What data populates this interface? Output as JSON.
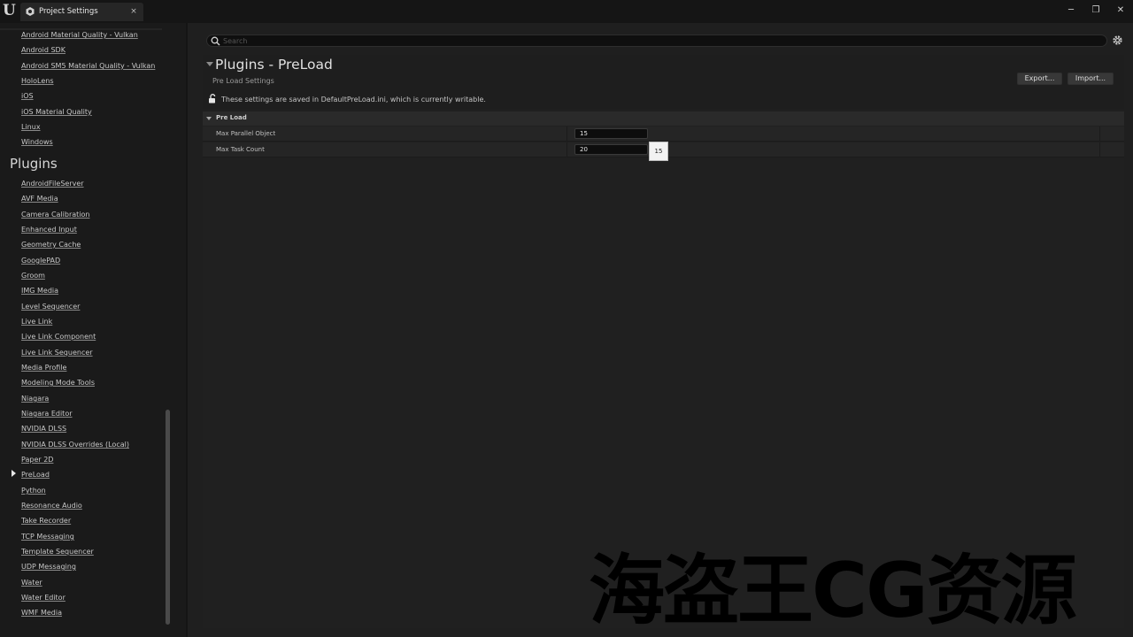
{
  "window": {
    "tab_label": "Project Settings",
    "tab_close_glyph": "×",
    "minimize_glyph": "─",
    "restore_glyph": "❐",
    "close_glyph": "✕"
  },
  "sidebar": {
    "platform_items": [
      "Android Material Quality - Vulkan",
      "Android SDK",
      "Android SM5 Material Quality - Vulkan",
      "HoloLens",
      "iOS",
      "iOS Material Quality",
      "Linux",
      "Windows"
    ],
    "plugins_heading": "Plugins",
    "plugin_items": [
      "AndroidFileServer",
      "AVF Media",
      "Camera Calibration",
      "Enhanced Input",
      "Geometry Cache",
      "GooglePAD",
      "Groom",
      "IMG Media",
      "Level Sequencer",
      "Live Link",
      "Live Link Component",
      "Live Link Sequencer",
      "Media Profile",
      "Modeling Mode Tools",
      "Niagara",
      "Niagara Editor",
      "NVIDIA DLSS",
      "NVIDIA DLSS Overrides (Local)",
      "Paper 2D",
      "PreLoad",
      "Python",
      "Resonance Audio",
      "Take Recorder",
      "TCP Messaging",
      "Template Sequencer",
      "UDP Messaging",
      "Water",
      "Water Editor",
      "WMF Media"
    ],
    "selected_item": "PreLoad"
  },
  "search": {
    "placeholder": "Search",
    "value": ""
  },
  "page": {
    "title": "Plugins - PreLoad",
    "subtitle": "Pre Load Settings",
    "writable_notice": "These settings are saved in DefaultPreLoad.ini, which is currently writable.",
    "export_label": "Export...",
    "import_label": "Import..."
  },
  "section": {
    "label": "Pre Load",
    "properties": [
      {
        "label": "Max Parallel Object",
        "value": "15"
      },
      {
        "label": "Max Task Count",
        "value": "20"
      }
    ],
    "tooltip_value": "15"
  },
  "watermark": "海盗王CG资源",
  "icons": {
    "tab": "unreal-settings-icon",
    "search": "search-icon",
    "settings": "gear-icon",
    "lock": "unlocked-icon"
  },
  "colors": {
    "background": "#151515",
    "panel": "#1f1f1f",
    "section_header": "#2a2a2a",
    "row": "#252525",
    "text": "#c8c8c8"
  }
}
